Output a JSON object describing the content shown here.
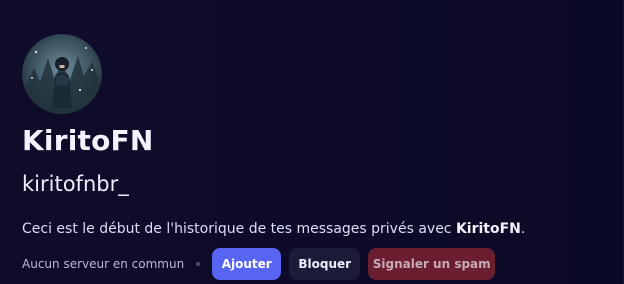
{
  "profile": {
    "display_name": "KiritoFN",
    "username": "kiritofnbr_",
    "intro_prefix": "Ceci est le début de l'historique de tes messages privés avec ",
    "intro_name": "KiritoFN",
    "intro_suffix": "."
  },
  "actions": {
    "mutual_servers": "Aucun serveur en commun",
    "add_label": "Ajouter",
    "block_label": "Bloquer",
    "spam_label": "Signaler un spam"
  },
  "colors": {
    "background": "#0f0c2a",
    "accent": "#5865f2",
    "danger": "#6b1e30",
    "secondary_button": "#1c1b37"
  },
  "icons": {
    "avatar": "user-avatar"
  }
}
